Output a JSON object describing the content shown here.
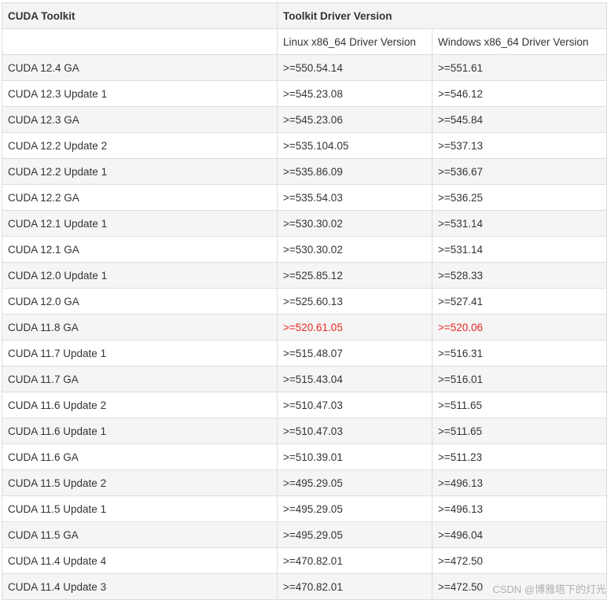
{
  "header": {
    "col_toolkit": "CUDA Toolkit",
    "col_driver": "Toolkit Driver Version",
    "sub_linux": "Linux x86_64 Driver Version",
    "sub_windows": "Windows x86_64 Driver Version"
  },
  "rows": [
    {
      "toolkit": "CUDA 12.4 GA",
      "linux": ">=550.54.14",
      "windows": ">=551.61"
    },
    {
      "toolkit": "CUDA 12.3 Update 1",
      "linux": ">=545.23.08",
      "windows": ">=546.12"
    },
    {
      "toolkit": "CUDA 12.3 GA",
      "linux": ">=545.23.06",
      "windows": ">=545.84"
    },
    {
      "toolkit": "CUDA 12.2 Update 2",
      "linux": ">=535.104.05",
      "windows": ">=537.13"
    },
    {
      "toolkit": "CUDA 12.2 Update 1",
      "linux": ">=535.86.09",
      "windows": ">=536.67"
    },
    {
      "toolkit": "CUDA 12.2 GA",
      "linux": ">=535.54.03",
      "windows": ">=536.25"
    },
    {
      "toolkit": "CUDA 12.1 Update 1",
      "linux": ">=530.30.02",
      "windows": ">=531.14"
    },
    {
      "toolkit": "CUDA 12.1 GA",
      "linux": ">=530.30.02",
      "windows": ">=531.14"
    },
    {
      "toolkit": "CUDA 12.0 Update 1",
      "linux": ">=525.85.12",
      "windows": ">=528.33"
    },
    {
      "toolkit": "CUDA 12.0 GA",
      "linux": ">=525.60.13",
      "windows": ">=527.41"
    },
    {
      "toolkit": "CUDA 11.8 GA",
      "linux": ">=520.61.05",
      "windows": ">=520.06"
    },
    {
      "toolkit": "CUDA 11.7 Update 1",
      "linux": ">=515.48.07",
      "windows": ">=516.31"
    },
    {
      "toolkit": "CUDA 11.7 GA",
      "linux": ">=515.43.04",
      "windows": ">=516.01"
    },
    {
      "toolkit": "CUDA 11.6 Update 2",
      "linux": ">=510.47.03",
      "windows": ">=511.65"
    },
    {
      "toolkit": "CUDA 11.6 Update 1",
      "linux": ">=510.47.03",
      "windows": ">=511.65"
    },
    {
      "toolkit": "CUDA 11.6 GA",
      "linux": ">=510.39.01",
      "windows": ">=511.23"
    },
    {
      "toolkit": "CUDA 11.5 Update 2",
      "linux": ">=495.29.05",
      "windows": ">=496.13"
    },
    {
      "toolkit": "CUDA 11.5 Update 1",
      "linux": ">=495.29.05",
      "windows": ">=496.13"
    },
    {
      "toolkit": "CUDA 11.5 GA",
      "linux": ">=495.29.05",
      "windows": ">=496.04"
    },
    {
      "toolkit": "CUDA 11.4 Update 4",
      "linux": ">=470.82.01",
      "windows": ">=472.50"
    },
    {
      "toolkit": "CUDA 11.4 Update 3",
      "linux": ">=470.82.01",
      "windows": ">=472.50"
    }
  ],
  "highlight_color": "#e8251e",
  "watermark": "CSDN @博雅塔下的灯光"
}
